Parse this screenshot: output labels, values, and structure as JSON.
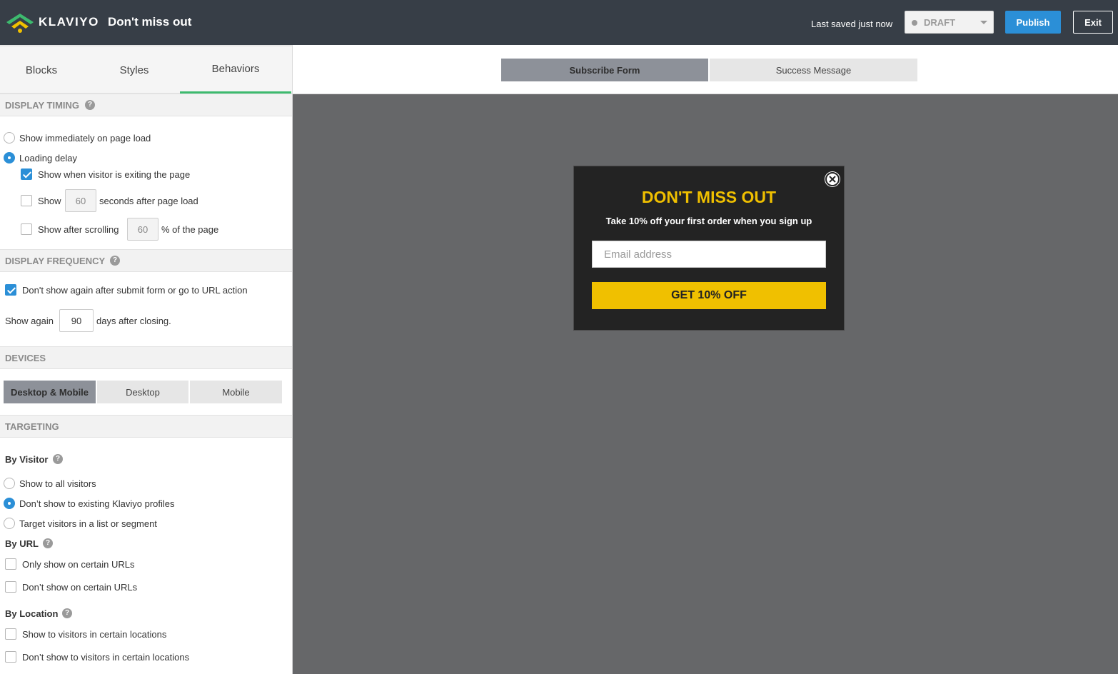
{
  "app": {
    "brand": "KLAVIYO",
    "document_title": "Don't miss out",
    "last_saved": "Last saved just now",
    "status": "DRAFT",
    "publish_label": "Publish",
    "exit_label": "Exit"
  },
  "sidebar": {
    "tabs": [
      {
        "label": "Blocks",
        "active": false
      },
      {
        "label": "Styles",
        "active": false
      },
      {
        "label": "Behaviors",
        "active": true
      }
    ],
    "display_timing": {
      "heading": "DISPLAY TIMING",
      "show_immediately": "Show immediately on page load",
      "loading_delay": "Loading delay",
      "exit_intent": "Show when visitor is exiting the page",
      "show_label": "Show",
      "seconds_value": "60",
      "seconds_after": "seconds after page load",
      "scroll_label": "Show after scrolling",
      "scroll_value": "60",
      "scroll_after": "% of the page"
    },
    "display_frequency": {
      "heading": "DISPLAY FREQUENCY",
      "dont_show_again": "Don't show again after submit form or go to URL action",
      "show_again_label": "Show again",
      "days_value": "90",
      "days_after": "days after closing."
    },
    "devices": {
      "heading": "DEVICES",
      "options": [
        "Desktop & Mobile",
        "Desktop",
        "Mobile"
      ],
      "selected": "Desktop & Mobile"
    },
    "targeting": {
      "heading": "TARGETING",
      "by_visitor": "By Visitor",
      "visitor_options": [
        "Show to all visitors",
        "Don’t show to existing Klaviyo profiles",
        "Target visitors in a list or segment"
      ],
      "by_url": "By URL",
      "url_options": [
        "Only show on certain URLs",
        "Don’t show on certain URLs"
      ],
      "by_location": "By Location",
      "location_options": [
        "Show to visitors in certain locations",
        "Don’t show to visitors in certain locations"
      ]
    }
  },
  "main": {
    "tabs": [
      {
        "label": "Subscribe Form",
        "active": true
      },
      {
        "label": "Success Message",
        "active": false
      }
    ],
    "popup": {
      "title": "DON'T MISS OUT",
      "subtitle": "Take 10% off your first order when you sign up",
      "email_placeholder": "Email address",
      "cta_label": "GET 10% OFF"
    }
  },
  "icons": {
    "logo": "klaviyo-wifi-logo-icon",
    "help": "question-circle-icon",
    "close": "close-circle-icon",
    "caret": "caret-down-icon"
  },
  "colors": {
    "topbar": "#373e47",
    "accent_blue": "#2b8fd7",
    "active_tab_green": "#3dba6e",
    "popup_yellow": "#f0c000",
    "popup_bg": "#232323",
    "canvas_bg": "#666769"
  }
}
